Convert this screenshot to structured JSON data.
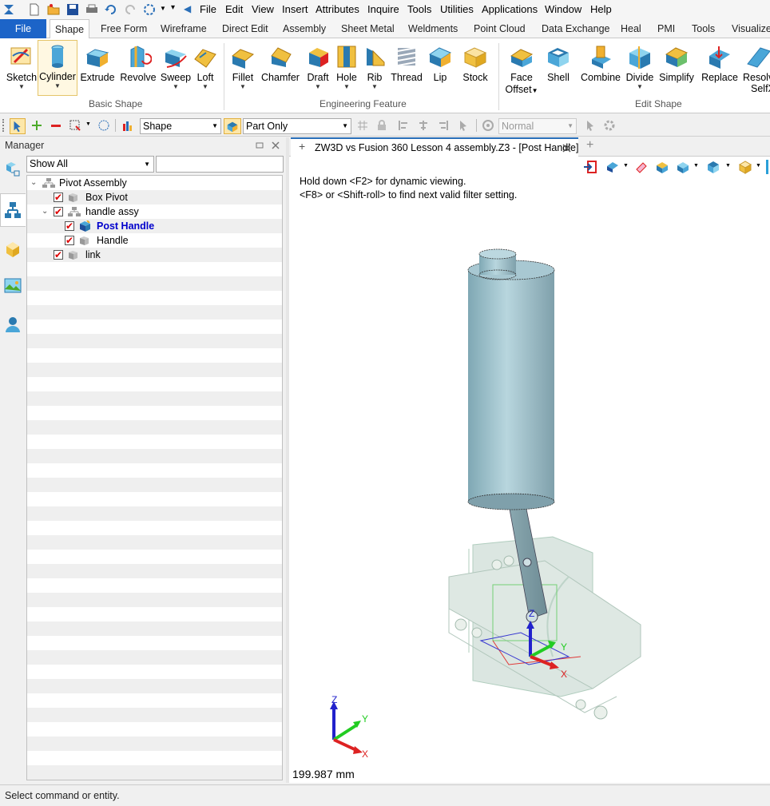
{
  "menubar": {
    "items": [
      "File",
      "Edit",
      "View",
      "Insert",
      "Attributes",
      "Inquire",
      "Tools",
      "Utilities",
      "Applications",
      "Window",
      "Help"
    ]
  },
  "tabs": {
    "items": [
      "File",
      "Shape",
      "Free Form",
      "Wireframe",
      "Direct Edit",
      "Assembly",
      "Sheet Metal",
      "Weldments",
      "Point Cloud",
      "Data Exchange",
      "Heal",
      "PMI",
      "Tools",
      "Visualize"
    ],
    "active": "Shape"
  },
  "ribbon": {
    "buttons": [
      "Sketch",
      "Cylinder",
      "Extrude",
      "Revolve",
      "Sweep",
      "Loft",
      "Fillet",
      "Chamfer",
      "Draft",
      "Hole",
      "Rib",
      "Thread",
      "Lip",
      "Stock",
      "Face",
      "Offset",
      "Shell",
      "Combine",
      "Divide",
      "Simplify",
      "Replace",
      "Resolv",
      "SelfX"
    ],
    "groups": [
      "Basic Shape",
      "Engineering Feature",
      "Edit Shape"
    ]
  },
  "toolbar2": {
    "filter": "Shape",
    "scope": "Part Only",
    "mode": "Normal"
  },
  "manager": {
    "title": "Manager",
    "filter": "Show All",
    "tree": [
      {
        "label": "Pivot Assembly"
      },
      {
        "label": "Box Pivot"
      },
      {
        "label": "handle assy"
      },
      {
        "label": "Post Handle"
      },
      {
        "label": "Handle"
      },
      {
        "label": "link"
      }
    ]
  },
  "doc": {
    "tab_title": "ZW3D vs Fusion 360 Lesson 4 assembly.Z3 - [Post Handle]"
  },
  "viewport": {
    "hint1": "Hold down <F2> for dynamic viewing.",
    "hint2": "<F8> or <Shift-roll> to find next valid filter setting.",
    "scale": "199.987 mm",
    "axes": {
      "x": "X",
      "y": "Y",
      "z": "Z"
    }
  },
  "status": {
    "text": "Select command or entity."
  },
  "colors": {
    "file_tab": "#1c64c8",
    "post_handle": "#0000cc",
    "cylinder": "#9ec3cc"
  }
}
